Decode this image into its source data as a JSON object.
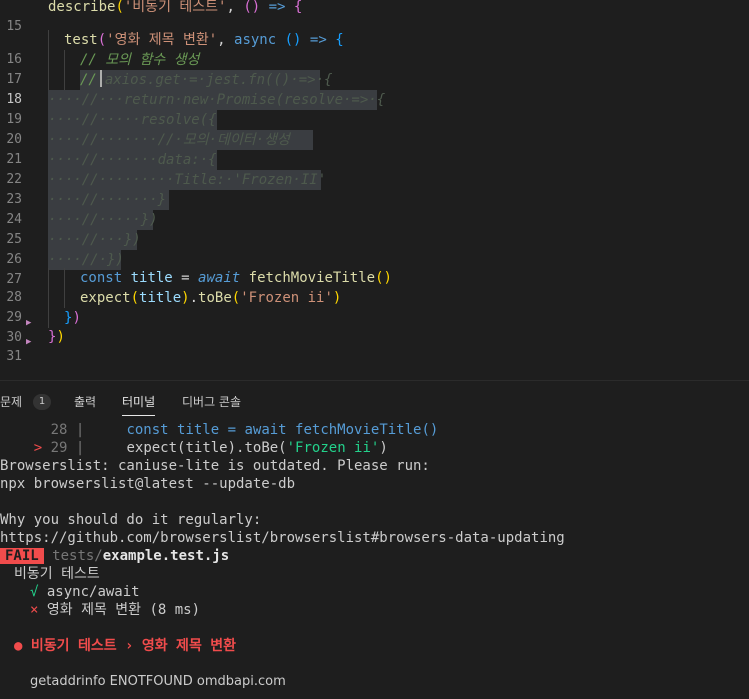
{
  "editor": {
    "line_numbers": [
      "15",
      "16",
      "17",
      "18",
      "19",
      "20",
      "21",
      "22",
      "23",
      "24",
      "25",
      "26",
      "27",
      "28",
      "29",
      "30",
      "31"
    ],
    "l15": {
      "fn": "describe",
      "open": "(",
      "str": "'비동기 테스트'",
      "comma": ", ",
      "paren": "()",
      "arrow": " => ",
      "brace": "{"
    },
    "l16": {
      "fn": "test",
      "open": "(",
      "str": "'영화 제목 변환'",
      "comma": ", ",
      "async": "async",
      "paren": " ()",
      "arrow": " => ",
      "brace": "{"
    },
    "l17": "// 모의 함수 생성",
    "l18_pre": "//",
    "l18_post": "axios.get·=·jest.fn(()·=>·{",
    "l19": "····//···return·new·Promise(resolve·=>·{",
    "l20": "····//·····resolve({",
    "l21": "····//·······//·모의·데이터·생성",
    "l22": "····//·······data:·{",
    "l23": "····//·········Title:·'Frozen·II'",
    "l24": "····//·······}",
    "l25": "····//·····})",
    "l26": "····//···})",
    "l27": "····//·})",
    "l28": {
      "kw": "const",
      "var": "title",
      "eq": " = ",
      "await": "await",
      "fn": "fetchMovieTitle",
      "paren": "()"
    },
    "l29": {
      "fn": "expect",
      "open": "(",
      "var": "title",
      "close": ")",
      "dot": ".",
      "fn2": "toBe",
      "open2": "(",
      "str": "'Frozen ii'",
      "close2": ")"
    },
    "l30": {
      "brace": "}",
      "paren": ")"
    },
    "l31": {
      "brace": "}",
      "paren": ")"
    }
  },
  "panel": {
    "tabs": [
      {
        "label": "문제"
      },
      {
        "label": "출력"
      },
      {
        "label": "터미널"
      },
      {
        "label": "디버그 콘솔"
      }
    ],
    "problems_count": "1",
    "terminal": {
      "ctx1_num": "28",
      "ctx1_sep": " |     ",
      "ctx1_code": "const title = await fetchMovieTitle()",
      "ctx2_marker": ">",
      "ctx2_num": "29",
      "ctx2_sep": " |     ",
      "ctx2_code_pre": "expect(title).toBe(",
      "ctx2_str": "'Frozen ii'",
      "ctx2_code_post": ")",
      "bl1": "Browserslist: caniuse-lite is outdated. Please run:",
      "bl2": "npx browserslist@latest --update-db",
      "bl3": "Why you should do it regularly:",
      "bl4": "https://github.com/browserslist/browserslist#browsers-data-updating",
      "fail_label": "FAIL",
      "fail_path_dir": "tests/",
      "fail_path_file": "example.test.js",
      "suite": "비동기 테스트",
      "pass_mark": "√",
      "pass_name": "async/await",
      "fail_mark": "×",
      "fail_name": "영화 제목 변환 (8 ms)",
      "err_bullet": "●",
      "err_title": "비동기 테스트 › 영화 제목 변환",
      "err_msg": "getaddrinfo ENOTFOUND omdbapi.com"
    }
  }
}
